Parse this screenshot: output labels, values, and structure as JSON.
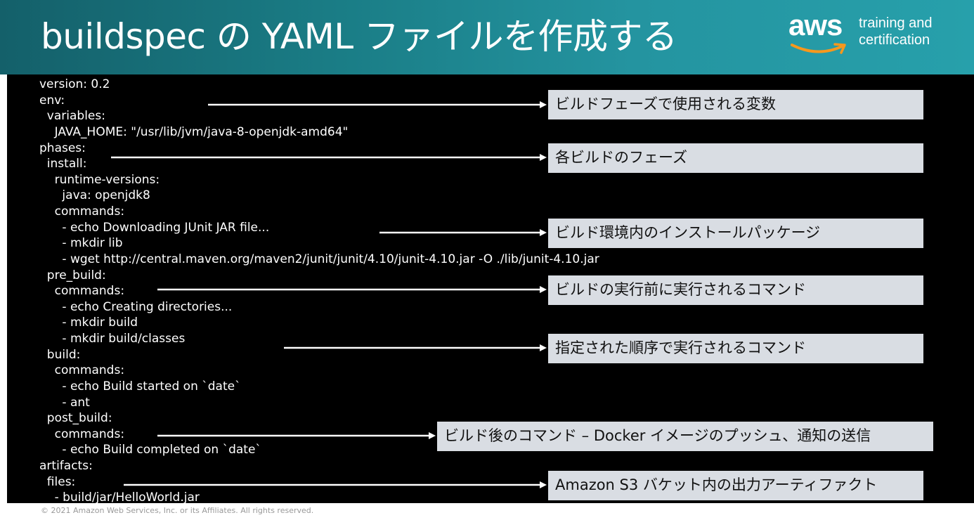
{
  "header": {
    "title": "buildspec の YAML ファイルを作成する",
    "logo_text": "aws",
    "logo_line1": "training and",
    "logo_line2": "certification"
  },
  "code_lines": [
    "version: 0.2",
    "env:",
    "  variables:",
    "    JAVA_HOME: \"/usr/lib/jvm/java-8-openjdk-amd64\"",
    "phases:",
    "  install:",
    "    runtime-versions:",
    "      java: openjdk8",
    "    commands:",
    "      - echo Downloading JUnit JAR file...",
    "      - mkdir lib",
    "      - wget http://central.maven.org/maven2/junit/junit/4.10/junit-4.10.jar -O ./lib/junit-4.10.jar",
    "  pre_build:",
    "    commands:",
    "      - echo Creating directories...",
    "      - mkdir build",
    "      - mkdir build/classes",
    "  build:",
    "    commands:",
    "      - echo Build started on `date`",
    "      - ant",
    "  post_build:",
    "    commands:",
    "      - echo Build completed on `date`",
    "artifacts:",
    "  files:",
    "    - build/jar/HelloWorld.jar"
  ],
  "callouts": [
    "ビルドフェーズで使用される変数",
    "各ビルドのフェーズ",
    "ビルド環境内のインストールパッケージ",
    "ビルドの実行前に実行されるコマンド",
    "指定された順序で実行されるコマンド",
    "ビルド後のコマンド – Docker イメージのプッシュ、通知の送信",
    "Amazon S3 バケット内の出力アーティファクト"
  ],
  "footer": "© 2021 Amazon Web Services, Inc. or its Affiliates. All rights reserved.",
  "colors": {
    "header_start": "#14606a",
    "header_end": "#27a0ab",
    "aws_smile": "#f7981d",
    "callout_bg": "#d9dde3",
    "code_bg": "#000000"
  }
}
